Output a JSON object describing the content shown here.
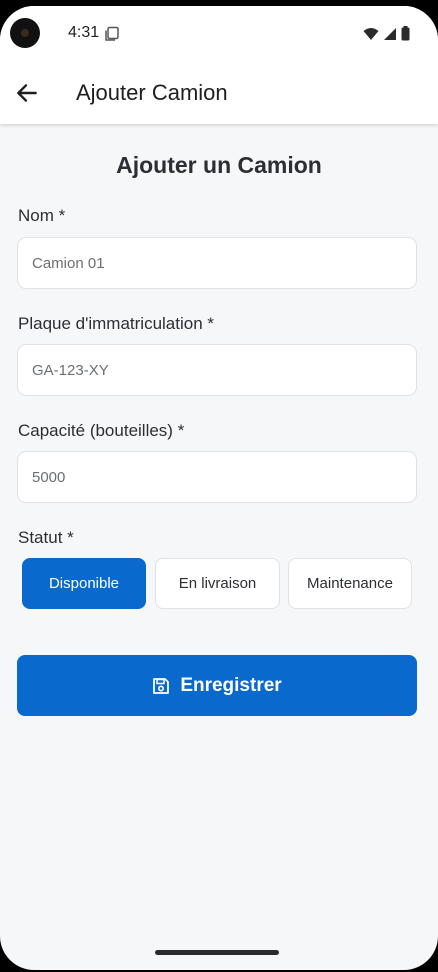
{
  "status_bar": {
    "time": "4:31"
  },
  "app_bar": {
    "title": "Ajouter Camion"
  },
  "form": {
    "title": "Ajouter un Camion",
    "name": {
      "label": "Nom *",
      "placeholder": "Camion 01"
    },
    "plate": {
      "label": "Plaque d'immatriculation *",
      "placeholder": "GA-123-XY"
    },
    "capacity": {
      "label": "Capacité (bouteilles) *",
      "placeholder": "5000"
    },
    "status": {
      "label": "Statut *",
      "options": [
        "Disponible",
        "En livraison",
        "Maintenance"
      ],
      "selected": "Disponible"
    },
    "save_label": "Enregistrer"
  },
  "colors": {
    "primary": "#0a69cc",
    "background": "#f6f7f9"
  }
}
